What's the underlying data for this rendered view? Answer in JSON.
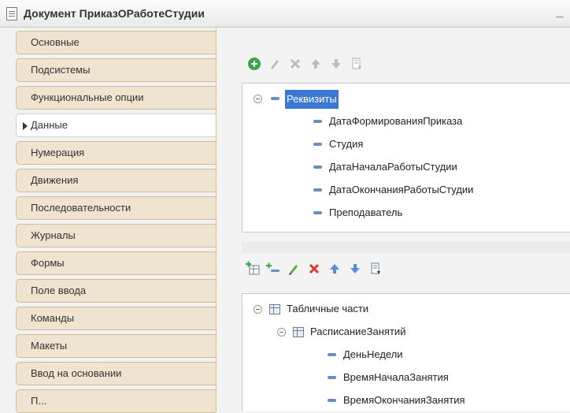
{
  "window": {
    "title": "Документ ПриказОРаботеСтудии",
    "minimize_glyph": "_"
  },
  "tabs": [
    {
      "label": "Основные"
    },
    {
      "label": "Подсистемы"
    },
    {
      "label": "Функциональные опции"
    },
    {
      "label": "Данные",
      "active": true
    },
    {
      "label": "Нумерация"
    },
    {
      "label": "Движения"
    },
    {
      "label": "Последовательности"
    },
    {
      "label": "Журналы"
    },
    {
      "label": "Формы"
    },
    {
      "label": "Поле ввода"
    },
    {
      "label": "Команды"
    },
    {
      "label": "Макеты"
    },
    {
      "label": "Ввод на основании"
    },
    {
      "label": "П..."
    }
  ],
  "attributes_toolbar": [
    "add-icon",
    "edit-icon",
    "delete-icon",
    "move-up-icon",
    "move-down-icon",
    "sort-icon"
  ],
  "attributes_tree": {
    "root": "Реквизиты",
    "items": [
      "ДатаФормированияПриказа",
      "Студия",
      "ДатаНачалаРаботыСтудии",
      "ДатаОкончанияРаботыСтудии",
      "Преподаватель"
    ]
  },
  "tabular_toolbar": [
    "add-table-icon",
    "add-attribute-icon",
    "edit-icon",
    "delete-icon",
    "move-up-icon",
    "move-down-icon",
    "sort-icon"
  ],
  "tabular_tree": {
    "root": "Табличные части",
    "section": "РасписаниеЗанятий",
    "items": [
      "ДеньНедели",
      "ВремяНачалаЗанятия",
      "ВремяОкончанияЗанятия"
    ]
  },
  "colors": {
    "accent_selection": "#3a78d4",
    "tab_bg": "#eee4cf",
    "add_green": "#3aa64a",
    "delete_red": "#d93a2b"
  }
}
